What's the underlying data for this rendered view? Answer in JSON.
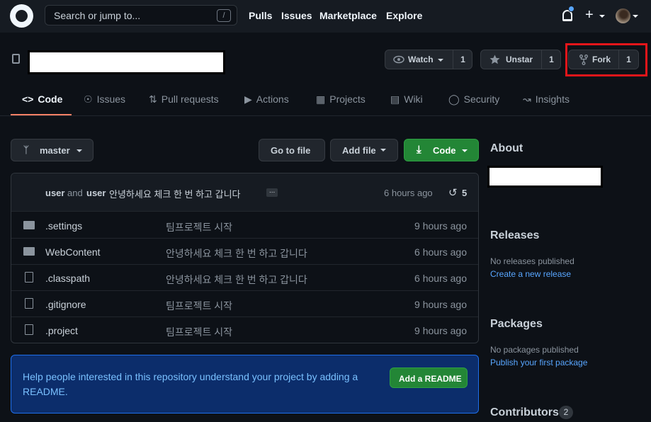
{
  "header": {
    "search_placeholder": "Search or jump to...",
    "search_shortcut": "/",
    "nav": [
      "Pulls",
      "Issues",
      "Marketplace",
      "Explore"
    ],
    "plus_label": "+"
  },
  "repo": {
    "watch_label": "Watch",
    "watch_count": "1",
    "unstar_label": "Unstar",
    "star_count": "1",
    "fork_label": "Fork",
    "fork_count": "1"
  },
  "tabs": [
    "Code",
    "Issues",
    "Pull requests",
    "Actions",
    "Projects",
    "Wiki",
    "Security",
    "Insights"
  ],
  "toolbar": {
    "branch": "master",
    "goto_file": "Go to file",
    "add_file": "Add file",
    "code": "Code"
  },
  "commit": {
    "author1": "user",
    "and": "and",
    "author2": "user",
    "message": "안녕하세요 체크 한 번 하고 갑니다",
    "ellipsis": "...",
    "time": "6 hours ago",
    "count": "5"
  },
  "files": [
    {
      "type": "folder",
      "name": ".settings",
      "message": "팀프로젝트 시작",
      "time": "9 hours ago"
    },
    {
      "type": "folder",
      "name": "WebContent",
      "message": "안녕하세요 체크 한 번 하고 갑니다",
      "time": "6 hours ago"
    },
    {
      "type": "file",
      "name": ".classpath",
      "message": "안녕하세요 체크 한 번 하고 갑니다",
      "time": "6 hours ago"
    },
    {
      "type": "file",
      "name": ".gitignore",
      "message": "팀프로젝트 시작",
      "time": "9 hours ago"
    },
    {
      "type": "file",
      "name": ".project",
      "message": "팀프로젝트 시작",
      "time": "9 hours ago"
    }
  ],
  "readme": {
    "text": "Help people interested in this repository understand your project by adding a README.",
    "button": "Add a README"
  },
  "sidebar": {
    "about": "About",
    "releases": "Releases",
    "no_releases": "No releases published",
    "create_release": "Create a new release",
    "packages": "Packages",
    "no_packages": "No packages published",
    "publish_package": "Publish your first package",
    "contributors": "Contributors",
    "contributors_count": "2"
  },
  "colors": {
    "background": "#0d1117",
    "header": "#161b22",
    "accent_green": "#238636",
    "link_blue": "#58a6ff",
    "highlight_red": "#e3151a"
  }
}
